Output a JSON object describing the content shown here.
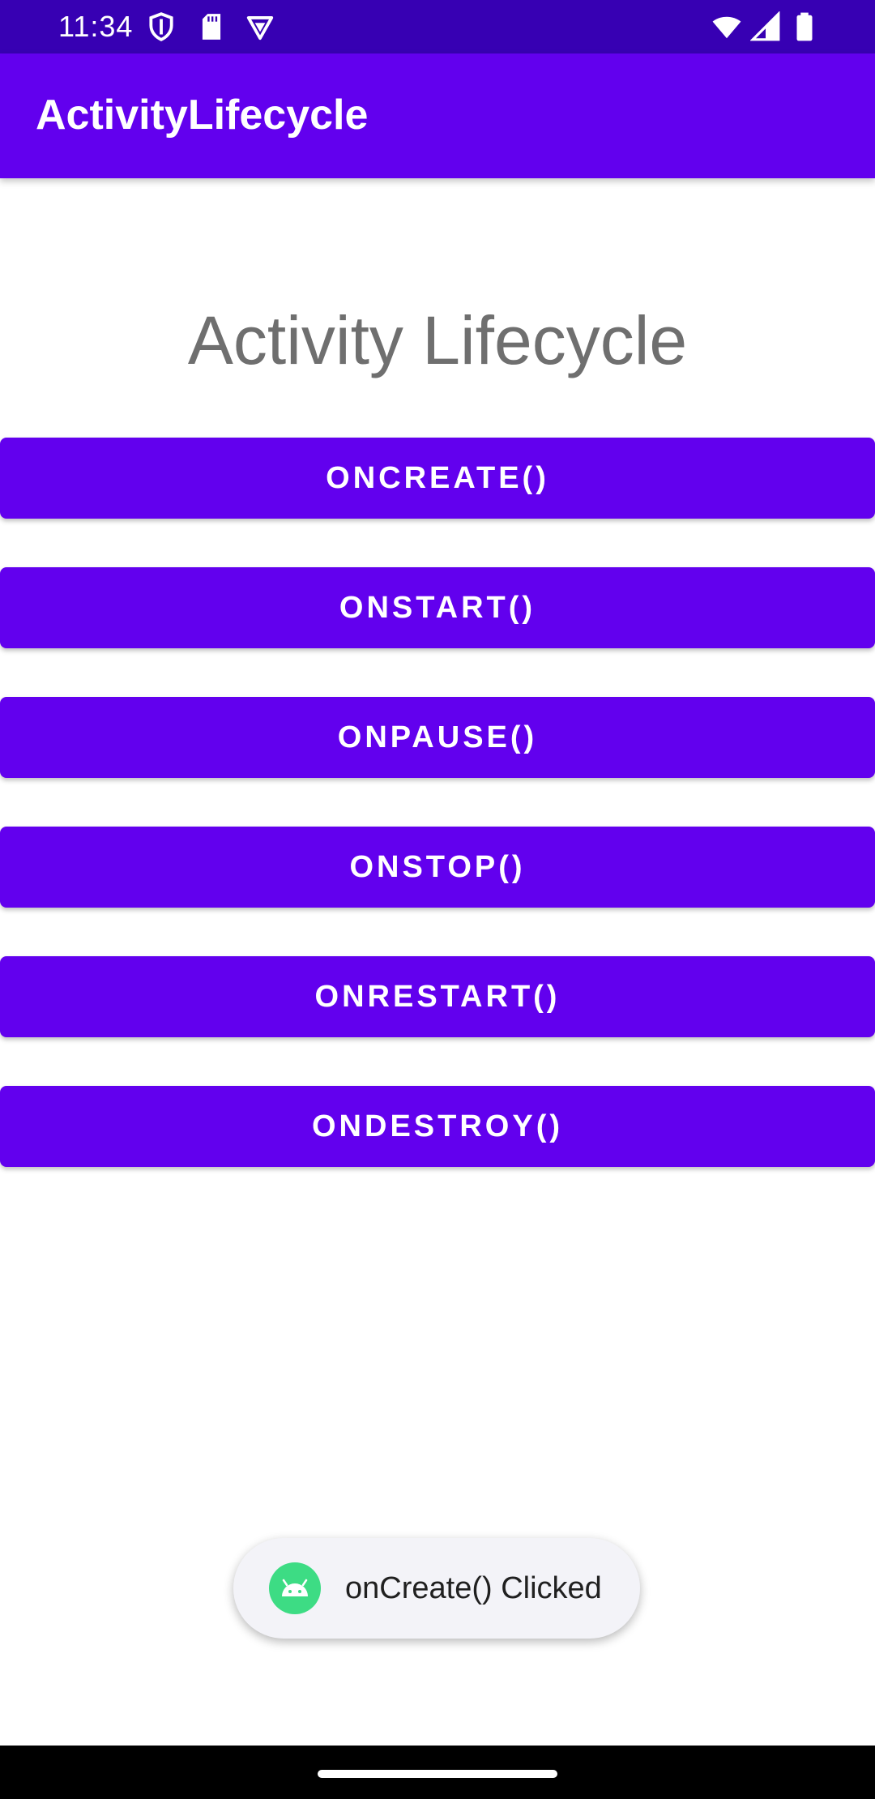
{
  "status_bar": {
    "time": "11:34",
    "icons_left": [
      "shield-icon",
      "sd-card-icon",
      "vpn-icon"
    ],
    "icons_right": [
      "wifi-icon",
      "cell-signal-icon",
      "battery-icon"
    ]
  },
  "app_bar": {
    "title": "ActivityLifecycle"
  },
  "main": {
    "heading": "Activity Lifecycle",
    "buttons": [
      {
        "label": "ONCREATE()"
      },
      {
        "label": "ONSTART()"
      },
      {
        "label": "ONPAUSE()"
      },
      {
        "label": "ONSTOP()"
      },
      {
        "label": "ONRESTART()"
      },
      {
        "label": "ONDESTROY()"
      }
    ]
  },
  "toast": {
    "message": "onCreate() Clicked",
    "icon": "android-icon"
  },
  "colors": {
    "status_bar": "#3700b3",
    "primary": "#6200ee",
    "heading_text": "#6f6f6f",
    "toast_background": "#f3f3f8",
    "toast_icon": "#3ddc84"
  }
}
